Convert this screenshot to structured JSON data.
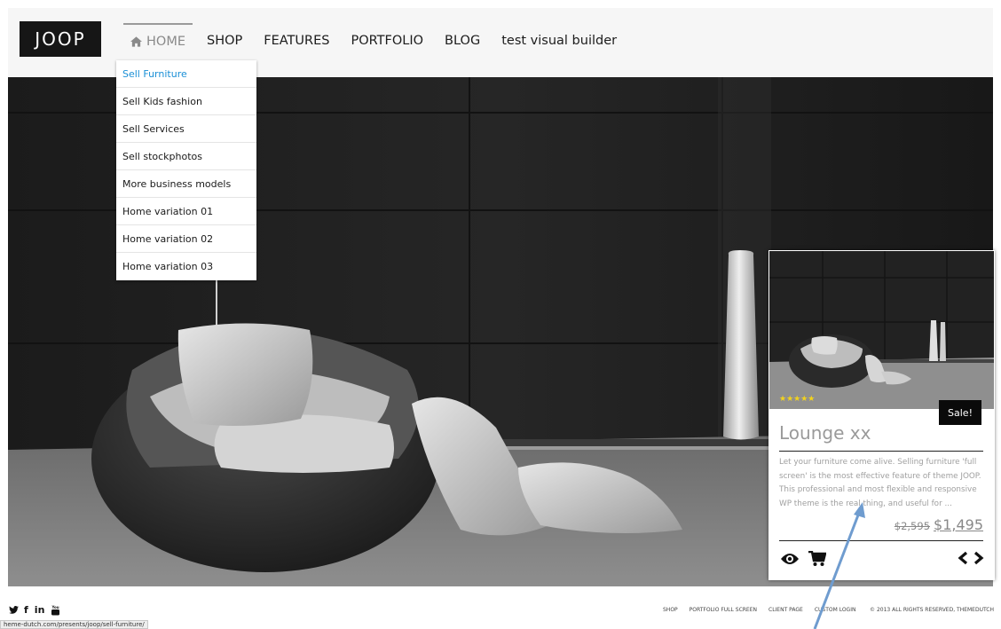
{
  "header": {
    "logo": "JOOP",
    "nav": [
      {
        "label": "HOME",
        "active": true,
        "icon": "home-icon"
      },
      {
        "label": "SHOP"
      },
      {
        "label": "FEATURES"
      },
      {
        "label": "PORTFOLIO"
      },
      {
        "label": "BLOG"
      },
      {
        "label": "test visual builder"
      }
    ]
  },
  "dropdown": {
    "items": [
      "Sell Furniture",
      "Sell Kids fashion",
      "Sell Services",
      "Sell stockphotos",
      "More business models",
      "Home variation 01",
      "Home variation 02",
      "Home variation 03"
    ],
    "active_index": 0
  },
  "product": {
    "rating_stars": "★★★★★",
    "rating": 5,
    "badge": "Sale!",
    "title": "Lounge xx",
    "description": "Let your furniture come alive. Selling furniture 'full screen' is the most effective feature of theme JOOP. This professional and most flexible and responsive WP theme is the real thing, and useful for ...",
    "price_old": "$2,595",
    "price_new": "$1,495",
    "icons": [
      "eye-icon",
      "cart-icon",
      "chevron-left-icon",
      "chevron-right-icon"
    ]
  },
  "footer": {
    "social": [
      "twitter-icon",
      "facebook-icon",
      "linkedin-icon",
      "youtube-icon"
    ],
    "social_glyphs": {
      "twitter": "🐦",
      "facebook": "f",
      "linkedin": "in",
      "youtube": "You"
    },
    "links": [
      "SHOP",
      "PORTFOLIO FULL SCREEN",
      "CLIENT PAGE",
      "CUSTOM LOGIN"
    ],
    "copyright": "© 2013 ALL RIGHTS RESERVED, THEMEDUTCH",
    "status_url": "heme-dutch.com/presents/joop/sell-furniture/"
  },
  "colors": {
    "accent": "#1a8fd6",
    "stars": "#f2d21c",
    "badge": "#0a0a0a",
    "annotation_arrow": "#6f9ccf"
  }
}
